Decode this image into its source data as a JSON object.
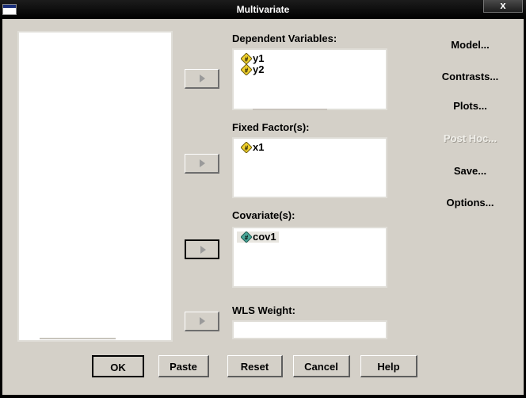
{
  "window": {
    "title": "Multivariate",
    "close_label": "x"
  },
  "dependent": {
    "label": "Dependent Variables:",
    "items": [
      "y1",
      "y2"
    ]
  },
  "fixed": {
    "label": "Fixed Factor(s):",
    "items": [
      "x1"
    ]
  },
  "covariate": {
    "label": "Covariate(s):",
    "items": [
      "cov1"
    ]
  },
  "wls": {
    "label": "WLS Weight:"
  },
  "side_buttons": {
    "model": "Model...",
    "contrasts": "Contrasts...",
    "plots": "Plots...",
    "posthoc": "Post Hoc...",
    "save": "Save...",
    "options": "Options..."
  },
  "bottom_buttons": {
    "ok": "OK",
    "paste": "Paste",
    "reset": "Reset",
    "cancel": "Cancel",
    "help": "Help"
  },
  "colors": {
    "dialog_bg": "#d4d0c8",
    "icon_yellow": "#f2d22c",
    "icon_teal": "#4aa89a"
  }
}
